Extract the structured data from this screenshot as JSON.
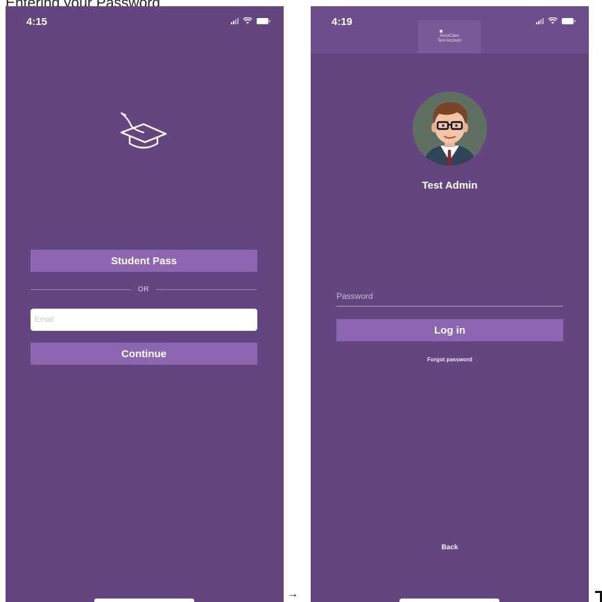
{
  "caption": "Entering your Password",
  "screens": {
    "left": {
      "time": "4:15",
      "student_pass_label": "Student Pass",
      "or_label": "OR",
      "email_placeholder": "Email",
      "continue_label": "Continue",
      "icon": "graduation-cap-icon"
    },
    "right": {
      "time": "4:19",
      "logo_line1": "AccuClass",
      "logo_line2": "Test Account",
      "user_name": "Test Admin",
      "password_placeholder": "Password",
      "login_label": "Log in",
      "forgot_label": "Forgot password",
      "back_label": "Back"
    }
  },
  "between_arrow": "→",
  "colors": {
    "background": "#63457f",
    "button": "#8c66b1",
    "header": "#6e4d8c",
    "text": "#ffffff"
  }
}
